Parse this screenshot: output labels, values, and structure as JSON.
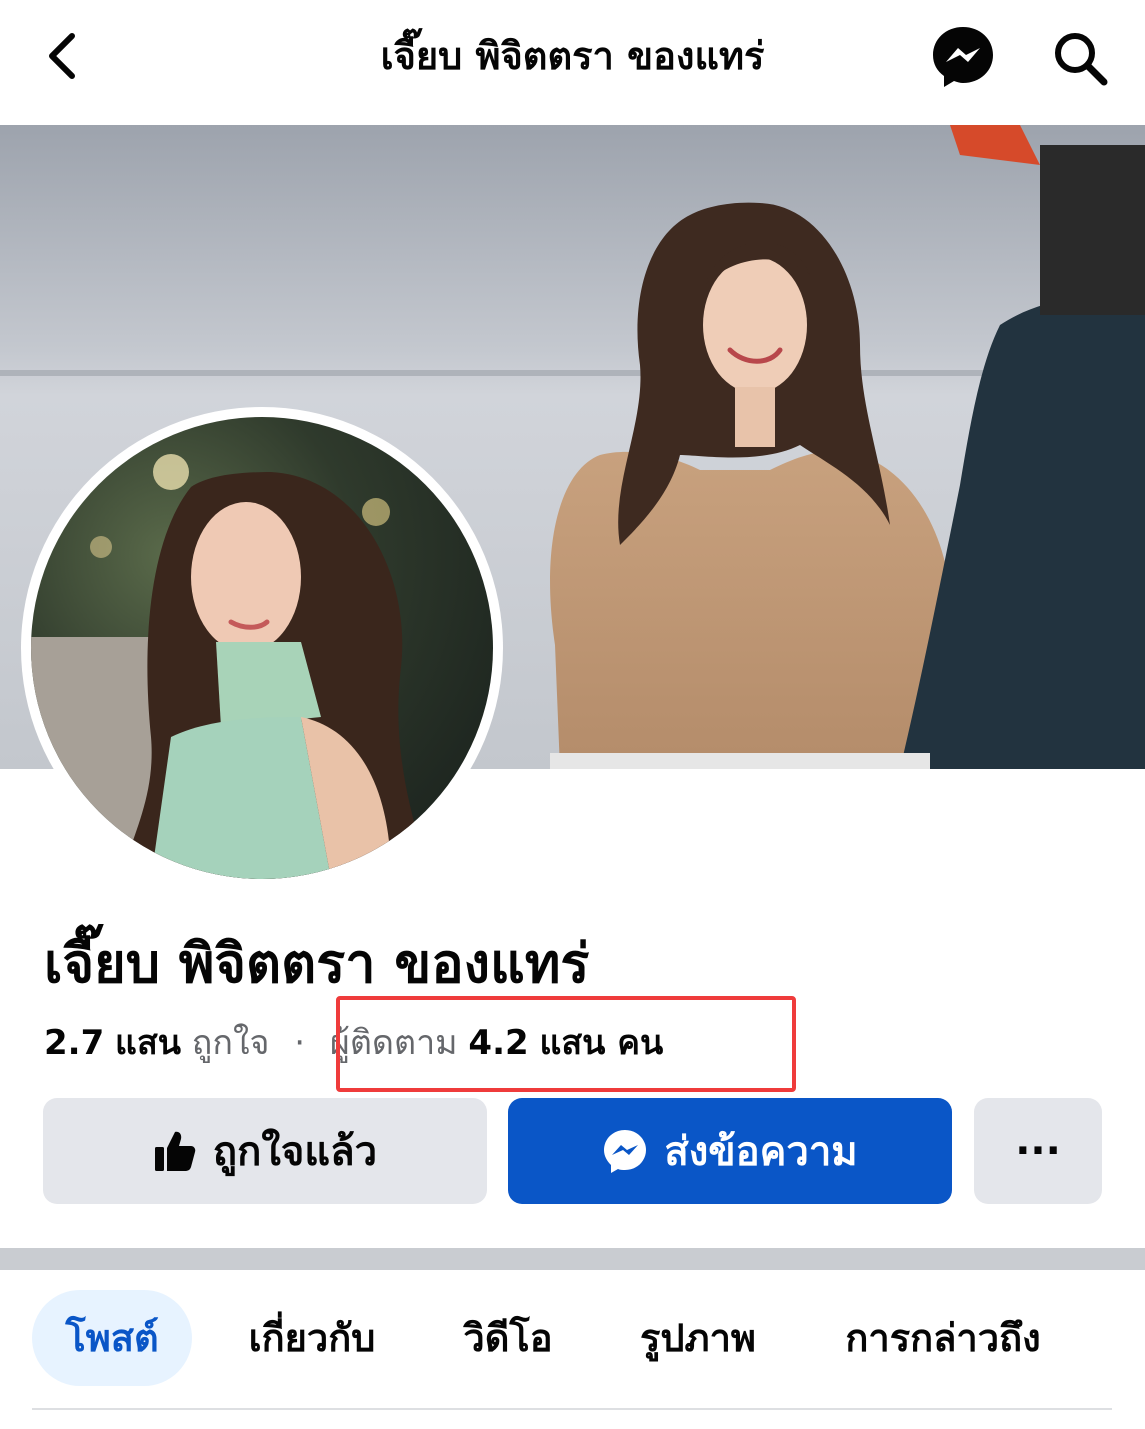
{
  "header": {
    "back_icon": "chevron-left-icon",
    "title": "เจี๊ยบ พิจิตตรา ของแทร่",
    "messenger_icon": "messenger-icon",
    "search_icon": "search-icon"
  },
  "profile": {
    "name": "เจี๊ยบ พิจิตตรา ของแทร่",
    "likes_value": "2.7",
    "likes_unit": "แสน",
    "likes_label": "ถูกใจ",
    "separator": "·",
    "followers_label": "ผู้ติดตาม",
    "followers_value": "4.2",
    "followers_unit": "แสน คน"
  },
  "actions": {
    "liked_label": "ถูกใจแล้ว",
    "message_label": "ส่งข้อความ",
    "more_label": "···"
  },
  "tabs": [
    {
      "label": "โพสต์",
      "active": true
    },
    {
      "label": "เกี่ยวกับ",
      "active": false
    },
    {
      "label": "วิดีโอ",
      "active": false
    },
    {
      "label": "รูปภาพ",
      "active": false
    },
    {
      "label": "การกล่าวถึง",
      "active": false
    }
  ],
  "colors": {
    "accent": "#0a56c7",
    "highlight": "#ef3b3b",
    "button_gray": "#e4e6eb",
    "active_tab_bg": "#e7f3ff"
  }
}
